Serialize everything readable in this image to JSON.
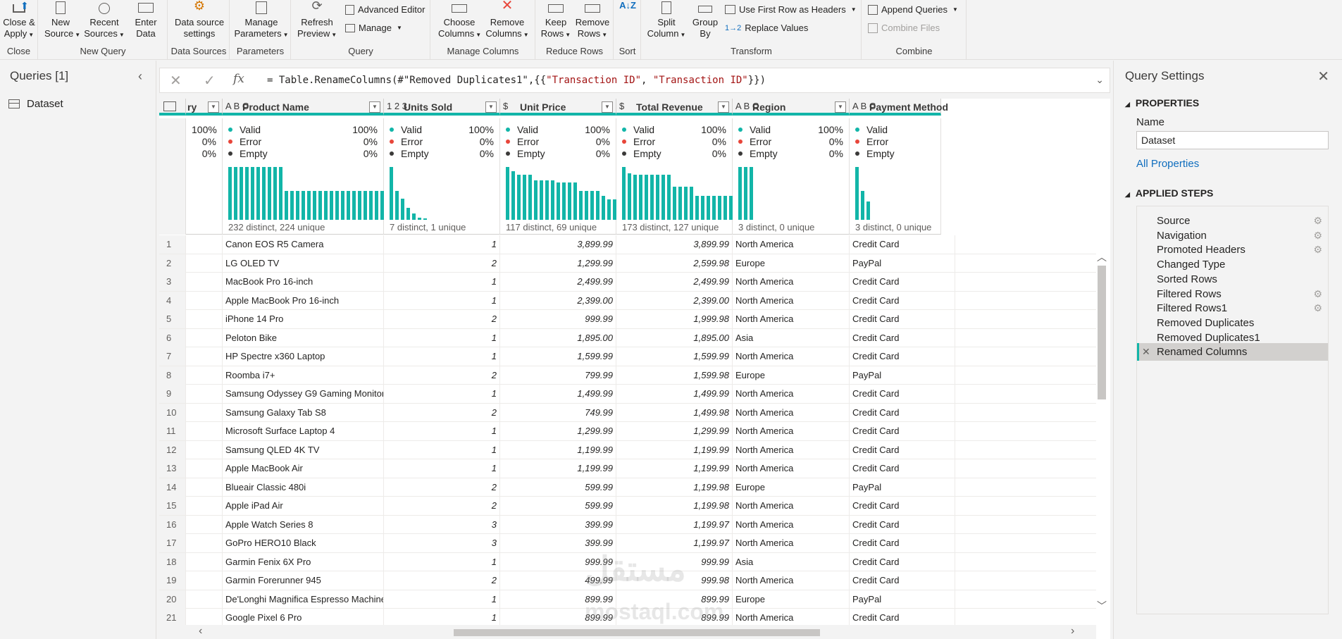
{
  "ribbon": {
    "close": {
      "btn": "Close &",
      "btn2": "Apply",
      "label": "Close"
    },
    "new_query": {
      "new_source": "New",
      "new_source2": "Source",
      "recent": "Recent",
      "recent2": "Sources",
      "enter": "Enter",
      "enter2": "Data",
      "label": "New Query"
    },
    "data_sources": {
      "btn": "Data source",
      "btn2": "settings",
      "label": "Data Sources"
    },
    "parameters": {
      "btn": "Manage",
      "btn2": "Parameters",
      "label": "Parameters"
    },
    "query": {
      "refresh": "Refresh",
      "refresh2": "Preview",
      "advanced": "Advanced Editor",
      "manage": "Manage",
      "label": "Query"
    },
    "manage_columns": {
      "choose": "Choose",
      "choose2": "Columns",
      "remove": "Remove",
      "remove2": "Columns",
      "label": "Manage Columns"
    },
    "reduce_rows": {
      "keep": "Keep",
      "keep2": "Rows",
      "remove": "Remove",
      "remove2": "Rows",
      "label": "Reduce Rows"
    },
    "sort": {
      "label": "Sort"
    },
    "transform": {
      "split": "Split",
      "split2": "Column",
      "group": "Group",
      "group2": "By",
      "first_row": "Use First Row as Headers",
      "replace": "Replace Values",
      "label": "Transform"
    },
    "combine": {
      "append": "Append Queries",
      "combine": "Combine Files",
      "label": "Combine"
    }
  },
  "queries": {
    "title": "Queries [1]",
    "items": [
      "Dataset"
    ]
  },
  "formula": {
    "prefix": "= Table.RenameColumns(#\"Removed Duplicates1\",{{",
    "s1": "\"Transaction ID\"",
    "sep": ", ",
    "s2": "\"Transaction ID\"",
    "suffix": "}})"
  },
  "columns": [
    {
      "type": "",
      "name": "ry",
      "valid": "100%",
      "error": "0%",
      "empty": "0%",
      "distinct": ""
    },
    {
      "type": "A B C",
      "name": "Product Name",
      "valid": "100%",
      "error": "0%",
      "empty": "0%",
      "distinct": "232 distinct, 224 unique"
    },
    {
      "type": "1 2 3",
      "name": "Units Sold",
      "valid": "100%",
      "error": "0%",
      "empty": "0%",
      "distinct": "7 distinct, 1 unique"
    },
    {
      "type": "$",
      "name": "Unit Price",
      "valid": "100%",
      "error": "0%",
      "empty": "0%",
      "distinct": "117 distinct, 69 unique"
    },
    {
      "type": "$",
      "name": "Total Revenue",
      "valid": "100%",
      "error": "0%",
      "empty": "0%",
      "distinct": "173 distinct, 127 unique"
    },
    {
      "type": "A B C",
      "name": "Region",
      "valid": "100%",
      "error": "0%",
      "empty": "0%",
      "distinct": "3 distinct, 0 unique"
    },
    {
      "type": "A B C",
      "name": "Payment Method",
      "valid": "",
      "error": "",
      "empty": "",
      "distinct": "3 distinct, 0 unique"
    }
  ],
  "profile_labels": {
    "valid": "Valid",
    "error": "Error",
    "empty": "Empty"
  },
  "histograms": {
    "product": [
      1,
      1,
      1,
      1,
      1,
      1,
      1,
      1,
      1,
      1,
      0.55,
      0.55,
      0.55,
      0.55,
      0.55,
      0.55,
      0.55,
      0.55,
      0.55,
      0.55,
      0.55,
      0.55,
      0.55,
      0.55,
      0.55,
      0.55,
      0.55,
      0.55,
      0.55,
      0.55,
      0.55,
      0.55,
      0.55,
      0.55,
      0.55
    ],
    "units": [
      1,
      0.55,
      0.4,
      0.22,
      0.12,
      0.04,
      0.02
    ],
    "unit_price": [
      1,
      0.92,
      0.85,
      0.85,
      0.85,
      0.75,
      0.75,
      0.75,
      0.75,
      0.7,
      0.7,
      0.7,
      0.7,
      0.55,
      0.55,
      0.55,
      0.55,
      0.45,
      0.38,
      0.38,
      0.38,
      0.38,
      0.38
    ],
    "total_revenue": [
      1,
      0.88,
      0.85,
      0.85,
      0.85,
      0.85,
      0.85,
      0.85,
      0.85,
      0.62,
      0.62,
      0.62,
      0.62,
      0.45,
      0.45,
      0.45,
      0.45,
      0.45,
      0.45,
      0.45,
      0.45,
      0.45,
      0.45
    ],
    "region": [
      1,
      1,
      1
    ],
    "payment": [
      1,
      0.55,
      0.35
    ]
  },
  "rows": [
    {
      "n": "1",
      "product": "Canon EOS R5 Camera",
      "units": "1",
      "price": "3,899.99",
      "revenue": "3,899.99",
      "region": "North America",
      "payment": "Credit Card"
    },
    {
      "n": "2",
      "product": "LG OLED TV",
      "units": "2",
      "price": "1,299.99",
      "revenue": "2,599.98",
      "region": "Europe",
      "payment": "PayPal"
    },
    {
      "n": "3",
      "product": "MacBook Pro 16-inch",
      "units": "1",
      "price": "2,499.99",
      "revenue": "2,499.99",
      "region": "North America",
      "payment": "Credit Card"
    },
    {
      "n": "4",
      "product": "Apple MacBook Pro 16-inch",
      "units": "1",
      "price": "2,399.00",
      "revenue": "2,399.00",
      "region": "North America",
      "payment": "Credit Card"
    },
    {
      "n": "5",
      "product": "iPhone 14 Pro",
      "units": "2",
      "price": "999.99",
      "revenue": "1,999.98",
      "region": "North America",
      "payment": "Credit Card"
    },
    {
      "n": "6",
      "product": "Peloton Bike",
      "units": "1",
      "price": "1,895.00",
      "revenue": "1,895.00",
      "region": "Asia",
      "payment": "Credit Card"
    },
    {
      "n": "7",
      "product": "HP Spectre x360 Laptop",
      "units": "1",
      "price": "1,599.99",
      "revenue": "1,599.99",
      "region": "North America",
      "payment": "Credit Card"
    },
    {
      "n": "8",
      "product": "Roomba i7+",
      "units": "2",
      "price": "799.99",
      "revenue": "1,599.98",
      "region": "Europe",
      "payment": "PayPal"
    },
    {
      "n": "9",
      "product": "Samsung Odyssey G9 Gaming Monitor",
      "units": "1",
      "price": "1,499.99",
      "revenue": "1,499.99",
      "region": "North America",
      "payment": "Credit Card"
    },
    {
      "n": "10",
      "product": "Samsung Galaxy Tab S8",
      "units": "2",
      "price": "749.99",
      "revenue": "1,499.98",
      "region": "North America",
      "payment": "Credit Card"
    },
    {
      "n": "11",
      "product": "Microsoft Surface Laptop 4",
      "units": "1",
      "price": "1,299.99",
      "revenue": "1,299.99",
      "region": "North America",
      "payment": "Credit Card"
    },
    {
      "n": "12",
      "product": "Samsung QLED 4K TV",
      "units": "1",
      "price": "1,199.99",
      "revenue": "1,199.99",
      "region": "North America",
      "payment": "Credit Card"
    },
    {
      "n": "13",
      "product": "Apple MacBook Air",
      "units": "1",
      "price": "1,199.99",
      "revenue": "1,199.99",
      "region": "North America",
      "payment": "Credit Card"
    },
    {
      "n": "14",
      "product": "Blueair Classic 480i",
      "units": "2",
      "price": "599.99",
      "revenue": "1,199.98",
      "region": "Europe",
      "payment": "PayPal"
    },
    {
      "n": "15",
      "product": "Apple iPad Air",
      "units": "2",
      "price": "599.99",
      "revenue": "1,199.98",
      "region": "North America",
      "payment": "Credit Card"
    },
    {
      "n": "16",
      "product": "Apple Watch Series 8",
      "units": "3",
      "price": "399.99",
      "revenue": "1,199.97",
      "region": "North America",
      "payment": "Credit Card"
    },
    {
      "n": "17",
      "product": "GoPro HERO10 Black",
      "units": "3",
      "price": "399.99",
      "revenue": "1,199.97",
      "region": "North America",
      "payment": "Credit Card"
    },
    {
      "n": "18",
      "product": "Garmin Fenix 6X Pro",
      "units": "1",
      "price": "999.99",
      "revenue": "999.99",
      "region": "Asia",
      "payment": "Credit Card"
    },
    {
      "n": "19",
      "product": "Garmin Forerunner 945",
      "units": "2",
      "price": "499.99",
      "revenue": "999.98",
      "region": "North America",
      "payment": "Credit Card"
    },
    {
      "n": "20",
      "product": "De'Longhi Magnifica Espresso Machine",
      "units": "1",
      "price": "899.99",
      "revenue": "899.99",
      "region": "Europe",
      "payment": "PayPal"
    },
    {
      "n": "21",
      "product": "Google Pixel 6 Pro",
      "units": "1",
      "price": "899.99",
      "revenue": "899.99",
      "region": "North America",
      "payment": "Credit Card"
    }
  ],
  "settings": {
    "title": "Query Settings",
    "properties": "PROPERTIES",
    "name_label": "Name",
    "name_value": "Dataset",
    "all_properties": "All Properties",
    "applied_steps": "APPLIED STEPS",
    "steps": [
      {
        "name": "Source",
        "gear": true
      },
      {
        "name": "Navigation",
        "gear": true
      },
      {
        "name": "Promoted Headers",
        "gear": true
      },
      {
        "name": "Changed Type",
        "gear": false
      },
      {
        "name": "Sorted Rows",
        "gear": false
      },
      {
        "name": "Filtered Rows",
        "gear": true
      },
      {
        "name": "Filtered Rows1",
        "gear": true
      },
      {
        "name": "Removed Duplicates",
        "gear": false
      },
      {
        "name": "Removed Duplicates1",
        "gear": false
      },
      {
        "name": "Renamed Columns",
        "gear": false,
        "active": true
      }
    ]
  },
  "watermark": {
    "arabic": "مستقل",
    "latin": "mostaql.com"
  },
  "colors": {
    "accent": "#12b5a8",
    "valid": "#12b5a8",
    "error": "#e8463a",
    "empty": "#3b3a39"
  }
}
